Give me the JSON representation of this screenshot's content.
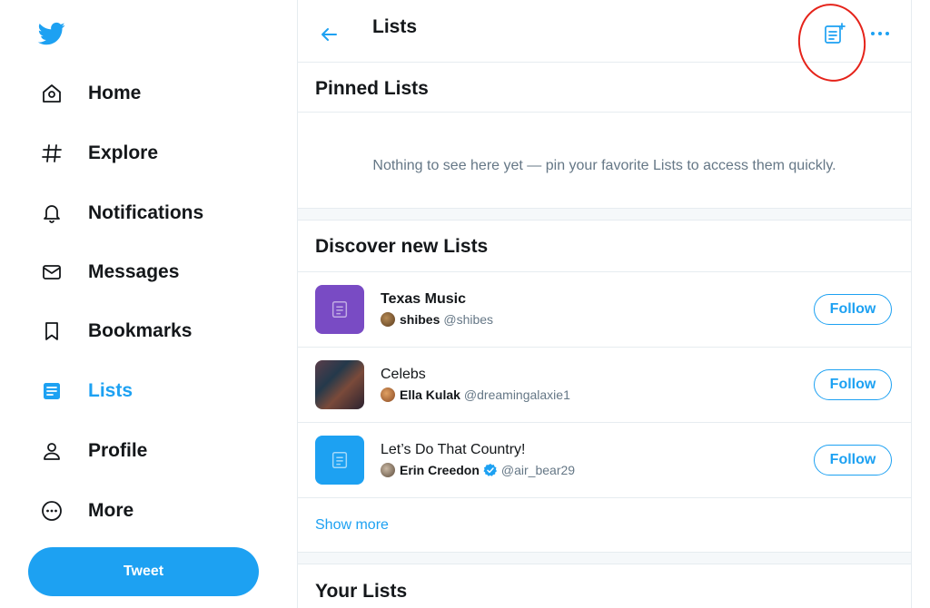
{
  "sidebar": {
    "items": [
      {
        "label": "Home",
        "icon": "home-icon"
      },
      {
        "label": "Explore",
        "icon": "hashtag-icon"
      },
      {
        "label": "Notifications",
        "icon": "bell-icon"
      },
      {
        "label": "Messages",
        "icon": "envelope-icon"
      },
      {
        "label": "Bookmarks",
        "icon": "bookmark-icon"
      },
      {
        "label": "Lists",
        "icon": "lists-icon",
        "active": true
      },
      {
        "label": "Profile",
        "icon": "person-icon"
      },
      {
        "label": "More",
        "icon": "more-circle-icon"
      }
    ],
    "tweet_label": "Tweet"
  },
  "header": {
    "title": "Lists"
  },
  "pinned": {
    "title": "Pinned Lists",
    "empty_text": "Nothing to see here yet — pin your favorite Lists to access them quickly."
  },
  "discover": {
    "title": "Discover new Lists",
    "lists": [
      {
        "name": "Texas Music",
        "owner_name": "shibes",
        "owner_handle": "@shibes",
        "verified": false,
        "follow_label": "Follow",
        "thumb_color": "#794bc4"
      },
      {
        "name": "Celebs",
        "owner_name": "Ella Kulak",
        "owner_handle": "@dreamingalaxie1",
        "verified": false,
        "follow_label": "Follow",
        "thumb_color": "#3b2a3e"
      },
      {
        "name": "Let’s Do That Country!",
        "owner_name": "Erin Creedon",
        "owner_handle": "@air_bear29",
        "verified": true,
        "follow_label": "Follow",
        "thumb_color": "#1da1f2"
      }
    ],
    "show_more": "Show more"
  },
  "your_lists": {
    "title": "Your Lists"
  },
  "colors": {
    "accent": "#1da1f2",
    "text": "#14171a",
    "muted": "#657786",
    "annotation": "#e5231a"
  }
}
